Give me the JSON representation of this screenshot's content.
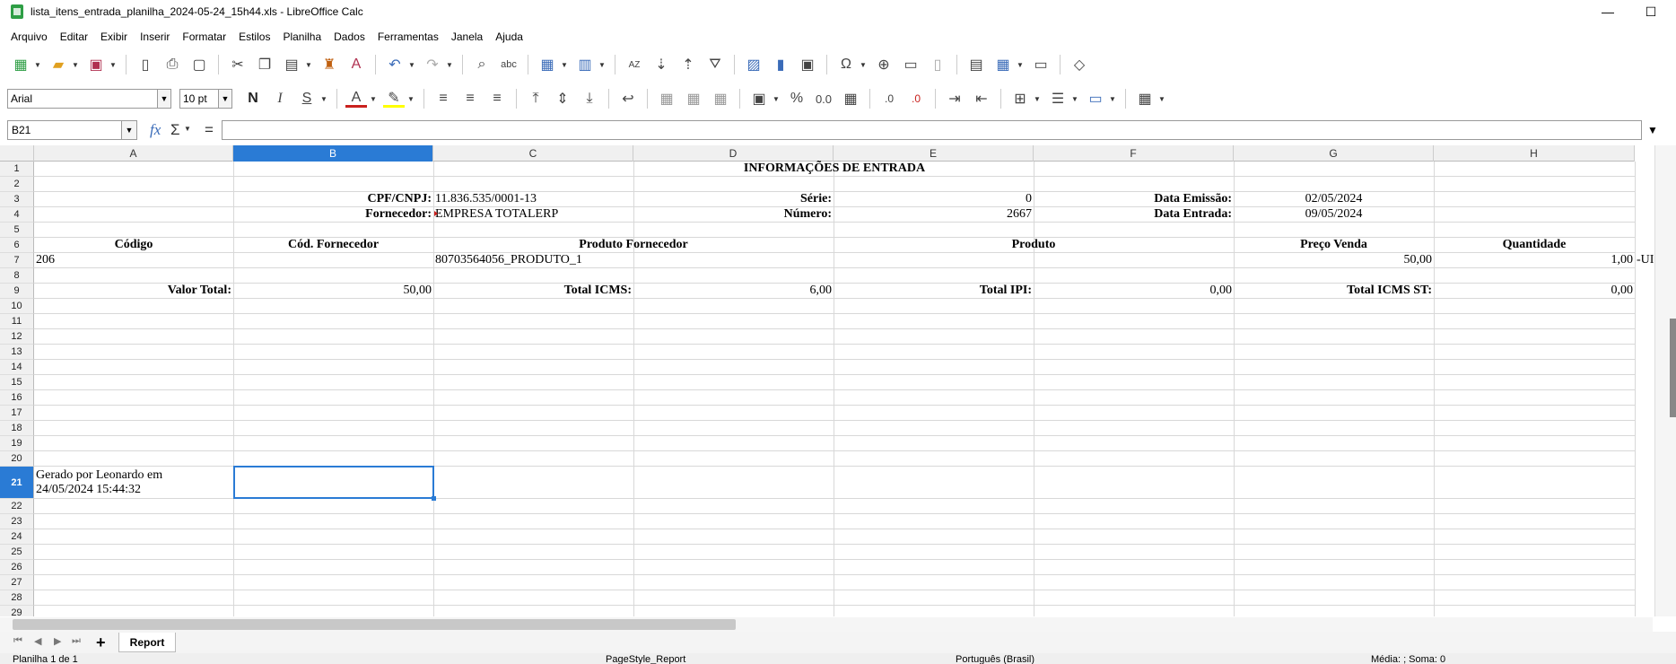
{
  "window": {
    "title": "lista_itens_entrada_planilha_2024-05-24_15h44.xls - LibreOffice Calc",
    "minimize": "—",
    "restore": "☐"
  },
  "menu": [
    "Arquivo",
    "Editar",
    "Exibir",
    "Inserir",
    "Formatar",
    "Estilos",
    "Planilha",
    "Dados",
    "Ferramentas",
    "Janela",
    "Ajuda"
  ],
  "format": {
    "font_name": "Arial",
    "font_size": "10 pt"
  },
  "formula": {
    "cell_ref": "B21",
    "fx": "fx",
    "sigma": "Σ",
    "equals": "=",
    "content": ""
  },
  "columns": [
    "A",
    "B",
    "C",
    "D",
    "E",
    "F",
    "G",
    "H"
  ],
  "selected_column": "B",
  "rows": [
    "1",
    "2",
    "3",
    "4",
    "5",
    "6",
    "7",
    "8",
    "9",
    "10",
    "11",
    "12",
    "13",
    "14",
    "15",
    "16",
    "17",
    "18",
    "19",
    "20",
    "21",
    "22",
    "23",
    "24",
    "25",
    "26",
    "27",
    "28",
    "29"
  ],
  "selected_row": "21",
  "cells": {
    "title": "INFORMAÇÕES DE ENTRADA",
    "cpf_label": "CPF/CNPJ:",
    "cpf_value": "11.836.535/0001-13",
    "serie_label": "Série:",
    "serie_value": "0",
    "emissao_label": "Data Emissão:",
    "emissao_value": "02/05/2024",
    "fornecedor_label": "Fornecedor:",
    "fornecedor_value": "EMPRESA TOTALERP",
    "numero_label": "Número:",
    "numero_value": "2667",
    "entrada_label": "Data Entrada:",
    "entrada_value": "09/05/2024",
    "h_codigo": "Código",
    "h_cod_forn": "Cód. Fornecedor",
    "h_prod_forn": "Produto Fornecedor",
    "h_produto": "Produto",
    "h_preco": "Preço Venda",
    "h_qtd": "Quantidade",
    "r7_codigo": "206",
    "r7_prod_forn": "80703564056_PRODUTO_1",
    "r7_preco": "50,00",
    "r7_qtd": "1,00",
    "r7_unit": "-UI",
    "valor_total_label": "Valor Total:",
    "valor_total": "50,00",
    "icms_label": "Total ICMS:",
    "icms": "6,00",
    "ipi_label": "Total IPI:",
    "ipi": "0,00",
    "icms_st_label": "Total ICMS ST:",
    "icms_st": "0,00",
    "gerado_l1": "Gerado por Leonardo  em",
    "gerado_l2": "24/05/2024 15:44:32"
  },
  "sheet_tab": "Report",
  "status": {
    "sheet": "Planilha 1 de 1",
    "page_style": "PageStyle_Report",
    "language": "Português (Brasil)",
    "summary": "Média: ; Soma: 0"
  }
}
